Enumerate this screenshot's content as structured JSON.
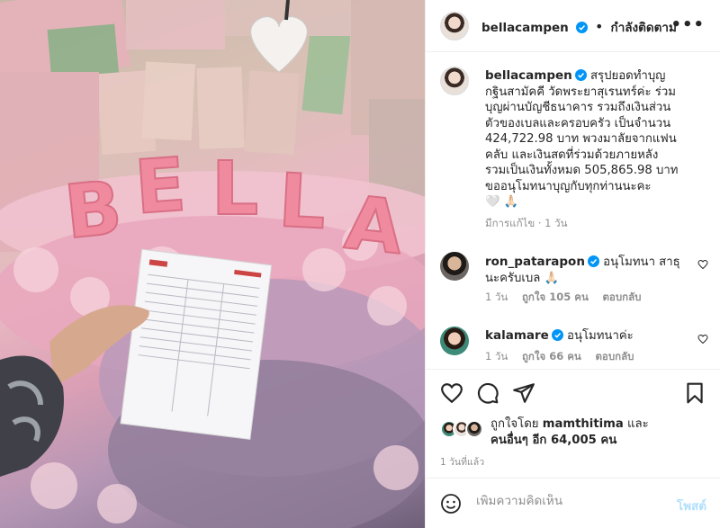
{
  "post": {
    "username": "bellacampen",
    "follow_status": "กำลังติดตาม",
    "more_label": "•••"
  },
  "caption": {
    "username": "bellacampen",
    "text_lines": [
      "สรุปยอดทำบุญ",
      "กฐินสามัคคี วัดพระยาสุเรนทร์ค่ะ ร่วม",
      "บุญผ่านบัญชีธนาคาร รวมถึงเงินส่วน",
      "ตัวของเบลและครอบครัว เป็นจำนวน",
      "424,722.98 บาท พวงมาลัยจากแฟน",
      "คลับ และเงินสดที่ร่วมด้วยภายหลัง",
      "รวมเป็นเงินทั้งหมด 505,865.98 บาท",
      "ขออนุโมทนาบุญกับทุกท่านนะคะ"
    ],
    "emoji": "🤍 🙏🏻",
    "edited": "มีการแก้ไข",
    "time": "1 วัน"
  },
  "comments": [
    {
      "username": "ron_patarapon",
      "text_lines": [
        "อนุโมทนา สาธุ",
        "นะครับเบล 🙏🏻"
      ],
      "time": "1 วัน",
      "likes": "ถูกใจ 105 คน",
      "reply": "ตอบกลับ"
    },
    {
      "username": "kalamare",
      "text_lines": [
        "อนุโมทนาค่ะ"
      ],
      "time": "1 วัน",
      "likes": "ถูกใจ 66 คน",
      "reply": "ตอบกลับ"
    }
  ],
  "likes": {
    "line1_prefix": "ถูกใจโดย",
    "line1_user": "mamthitima",
    "line1_suffix": "และ",
    "line2": "คนอื่นๆ อีก 64,005 คน"
  },
  "timestamp": "1 วันที่แล้ว",
  "add_comment": {
    "placeholder": "เพิ่มความคิดเห็น",
    "post_label": "โพสต์"
  },
  "photo": {
    "letters": [
      "B",
      "E",
      "L",
      "L",
      "A"
    ]
  },
  "colors": {
    "verified": "#0095f6",
    "post_disabled": "#b2dffc",
    "muted": "#8e8e8e"
  }
}
